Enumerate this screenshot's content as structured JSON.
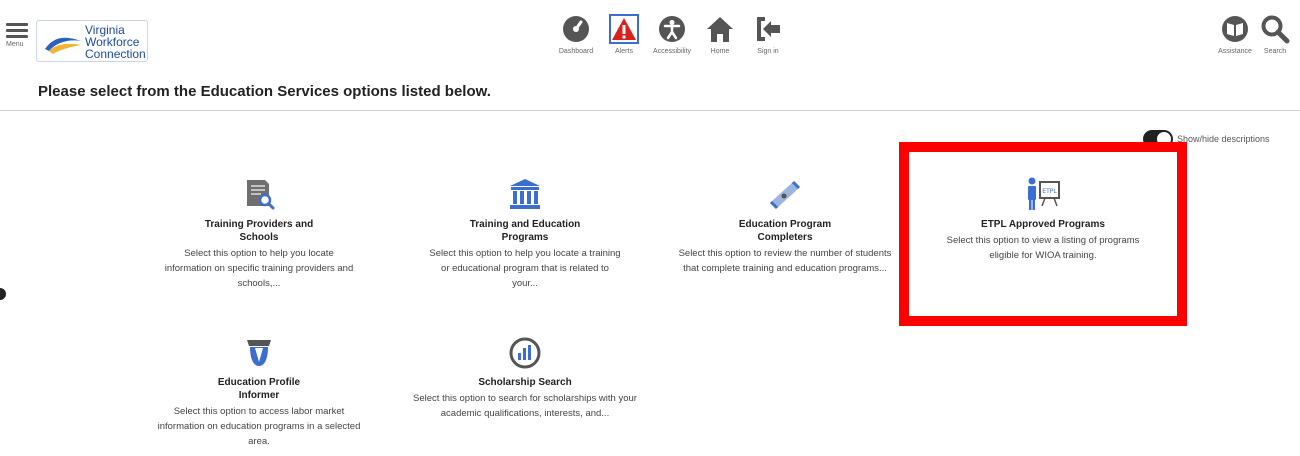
{
  "header": {
    "menu_label": "Menu",
    "logo_text": [
      "Virginia",
      "Workforce",
      "Connection"
    ],
    "nav": [
      {
        "id": "dashboard",
        "label": "Dashboard",
        "icon": "dashboard-gauge-icon"
      },
      {
        "id": "alerts",
        "label": "Alerts",
        "icon": "alert-triangle-icon"
      },
      {
        "id": "accessibility",
        "label": "Accessibility",
        "icon": "accessibility-icon"
      },
      {
        "id": "home",
        "label": "Home",
        "icon": "home-icon"
      },
      {
        "id": "signin",
        "label": "Sign in",
        "icon": "sign-in-icon"
      }
    ],
    "tools": [
      {
        "id": "assistance",
        "label": "Assistance",
        "icon": "book-icon"
      },
      {
        "id": "search",
        "label": "Search",
        "icon": "search-icon"
      }
    ]
  },
  "page": {
    "title": "Please select from the Education Services options listed below.",
    "toggle_label": "Show/hide descriptions"
  },
  "tiles": [
    {
      "title": "Training Providers and Schools",
      "desc": "Select this option to help you locate information on specific training providers and schools,...",
      "icon": "document-search-icon"
    },
    {
      "title": "Training and Education Programs",
      "desc": "Select this option to help you locate a training or educational program that is related to your...",
      "icon": "building-icon"
    },
    {
      "title": "Education Program Completers",
      "desc": "Select this option to review the number of students that complete training and education programs...",
      "icon": "diploma-icon"
    },
    {
      "title": "ETPL Approved Programs",
      "desc": "Select this option to view a listing of programs eligible for WIOA training.",
      "icon": "presenter-board-icon"
    },
    {
      "title": "Education Profile Informer",
      "desc": "Select this option to access labor market information on education programs in a selected area.",
      "icon": "graduate-icon"
    },
    {
      "title": "Scholarship Search",
      "desc": "Select this option to search for scholarships with your academic qualifications, interests, and...",
      "icon": "chart-magnifier-icon"
    }
  ],
  "colors": {
    "highlight": "#ff0000",
    "icon_blue": "#3c6ecf",
    "icon_gray": "#555555",
    "logo_blue": "#1b4ba5"
  }
}
